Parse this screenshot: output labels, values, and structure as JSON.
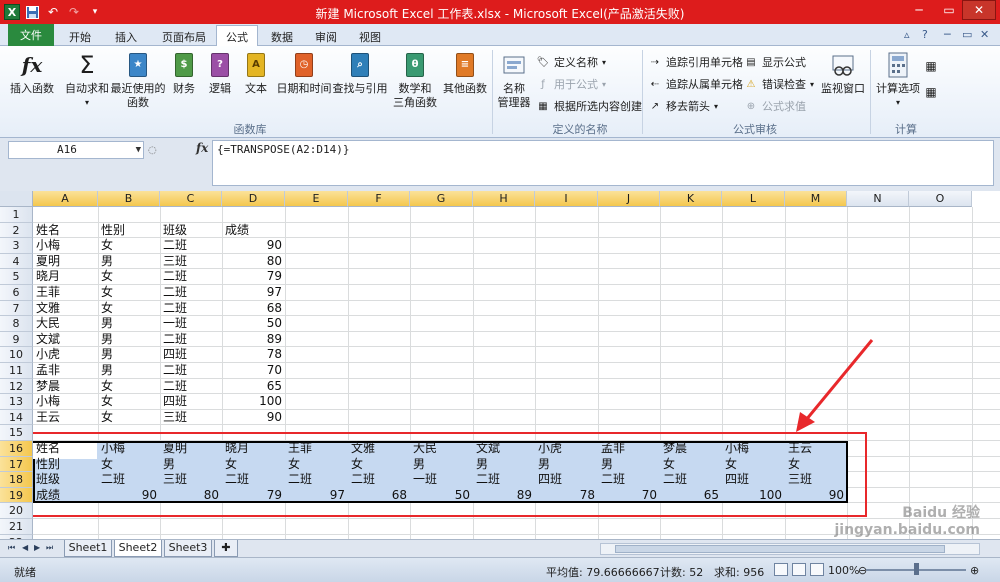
{
  "window": {
    "title": "新建 Microsoft Excel 工作表.xlsx  -  Microsoft Excel(产品激活失败)",
    "logo": "X"
  },
  "ribbon_tabs": [
    "开始",
    "插入",
    "页面布局",
    "公式",
    "数据",
    "审阅",
    "视图"
  ],
  "file_tab": "文件",
  "active_tab": "公式",
  "ribbon": {
    "function_library": {
      "insert_function": "插入函数",
      "autosum": "自动求和",
      "recent": "最近使用的\n函数",
      "financial": "财务",
      "logical": "逻辑",
      "text": "文本",
      "datetime": "日期和时间",
      "lookup": "查找与引用",
      "math": "数学和\n三角函数",
      "more": "其他函数",
      "group_label": "函数库"
    },
    "defined_names": {
      "name_manager": "名称\n管理器",
      "define_name": "定义名称",
      "use_in_formula": "用于公式",
      "create_from_selection": "根据所选内容创建",
      "group_label": "定义的名称"
    },
    "formula_auditing": {
      "trace_precedents": "追踪引用单元格",
      "trace_dependents": "追踪从属单元格",
      "remove_arrows": "移去箭头",
      "show_formulas": "显示公式",
      "error_checking": "错误检查",
      "evaluate_formula": "公式求值",
      "watch_window": "监视窗口",
      "group_label": "公式审核"
    },
    "calculation": {
      "calc_options": "计算选项",
      "group_label": "计算"
    }
  },
  "formula_bar": {
    "name_box": "A16",
    "fx": "fx",
    "formula": "{=TRANSPOSE(A2:D14)}"
  },
  "columns": [
    "A",
    "B",
    "C",
    "D",
    "E",
    "F",
    "G",
    "H",
    "I",
    "J",
    "K",
    "L",
    "M",
    "N",
    "O"
  ],
  "rows": [
    "1",
    "2",
    "3",
    "4",
    "5",
    "6",
    "7",
    "8",
    "9",
    "10",
    "11",
    "12",
    "13",
    "14",
    "15",
    "16",
    "17",
    "18",
    "19",
    "20",
    "21",
    "22"
  ],
  "cells": {
    "r2": [
      "姓名",
      "性别",
      "班级",
      "成绩"
    ],
    "source": [
      [
        "小梅",
        "女",
        "二班",
        "90"
      ],
      [
        "夏明",
        "男",
        "三班",
        "80"
      ],
      [
        "晓月",
        "女",
        "二班",
        "79"
      ],
      [
        "王菲",
        "女",
        "二班",
        "97"
      ],
      [
        "文雅",
        "女",
        "二班",
        "68"
      ],
      [
        "大民",
        "男",
        "一班",
        "50"
      ],
      [
        "文斌",
        "男",
        "二班",
        "89"
      ],
      [
        "小虎",
        "男",
        "四班",
        "78"
      ],
      [
        "孟非",
        "男",
        "二班",
        "70"
      ],
      [
        "梦晨",
        "女",
        "二班",
        "65"
      ],
      [
        "小梅",
        "女",
        "四班",
        "100"
      ],
      [
        "王云",
        "女",
        "三班",
        "90"
      ]
    ],
    "transposed": [
      [
        "姓名",
        "小梅",
        "夏明",
        "晓月",
        "王菲",
        "文雅",
        "大民",
        "文斌",
        "小虎",
        "孟非",
        "梦晨",
        "小梅",
        "王云"
      ],
      [
        "性别",
        "女",
        "男",
        "女",
        "女",
        "女",
        "男",
        "男",
        "男",
        "男",
        "女",
        "女",
        "女"
      ],
      [
        "班级",
        "二班",
        "三班",
        "二班",
        "二班",
        "二班",
        "一班",
        "二班",
        "四班",
        "二班",
        "二班",
        "四班",
        "三班"
      ],
      [
        "成绩",
        "90",
        "80",
        "79",
        "97",
        "68",
        "50",
        "89",
        "78",
        "70",
        "65",
        "100",
        "90"
      ]
    ]
  },
  "sheets": [
    "Sheet1",
    "Sheet2",
    "Sheet3"
  ],
  "active_sheet": "Sheet2",
  "status": {
    "mode": "就绪",
    "average": "平均值: 79.66666667",
    "count": "计数: 52",
    "sum": "求和: 956",
    "zoom": "100%"
  },
  "watermark": "Baidu 经验  jingyan.baidu.com",
  "colors": {
    "titlebar": "#dd1c1c",
    "file_tab": "#2a8a3e",
    "selection_fill": "#c6d9f1",
    "highlight_box": "#e8282b"
  }
}
